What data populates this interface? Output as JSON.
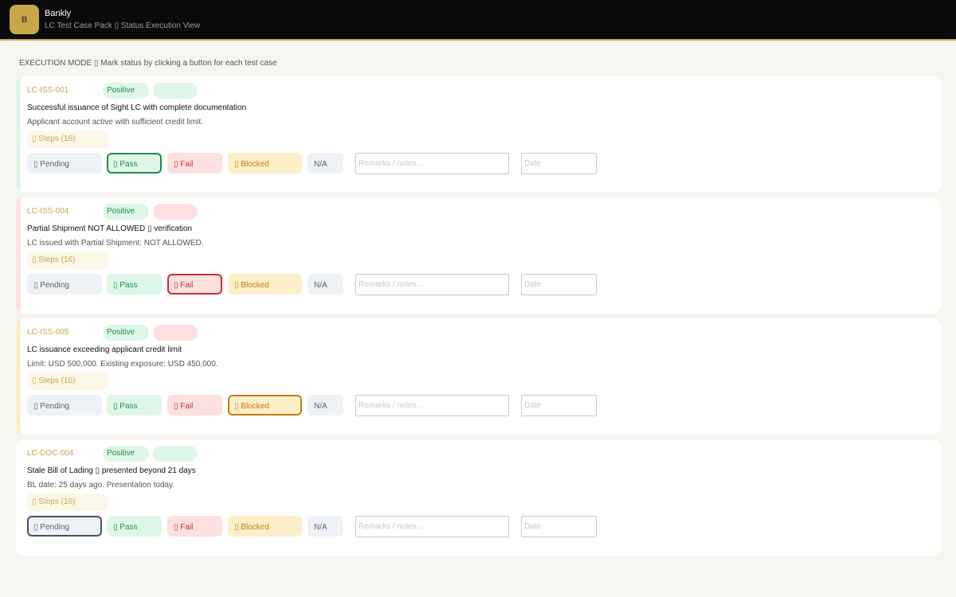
{
  "header": {
    "logo_letter": "B",
    "app_name": "Bankly",
    "subtitle": "LC Test Case Pack ▯ Status Execution View"
  },
  "mode_line": "EXECUTION MODE ▯ Mark status by clicking a button for each test case",
  "buttons": {
    "pending": "▯ Pending",
    "pass": "▯ Pass",
    "fail": "▯ Fail",
    "blocked": "▯ Blocked",
    "na": "N/A"
  },
  "inputs": {
    "remarks_placeholder": "Remarks / notes...",
    "date_placeholder": "Date"
  },
  "colors": {
    "pass": "#1e8b48",
    "fail": "#c43030",
    "blocked": "#c47d12",
    "pending": "#4a5266",
    "accent_gold": "#c9a64a"
  },
  "cases": [
    {
      "id": "LC-ISS-001",
      "type": "Positive",
      "title": "Successful issuance of Sight LC with complete documentation",
      "desc": "Applicant account active with sufficient credit limit.",
      "steps": "▯ Steps (16)",
      "selected": "pass"
    },
    {
      "id": "LC-ISS-004",
      "type": "Positive",
      "title": "Partial Shipment NOT ALLOWED ▯ verification",
      "desc": "LC issued with Partial Shipment: NOT ALLOWED.",
      "steps": "▯ Steps (16)",
      "selected": "fail"
    },
    {
      "id": "LC-ISS-005",
      "type": "Positive",
      "title": "LC issuance exceeding applicant credit limit",
      "desc": "Limit: USD 500,000. Existing exposure: USD 450,000.",
      "steps": "▯ Steps (16)",
      "selected": "blocked"
    },
    {
      "id": "LC-DOC-004",
      "type": "Positive",
      "title": "Stale Bill of Lading ▯ presented beyond 21 days",
      "desc": "BL date: 25 days ago. Presentation today.",
      "steps": "▯ Steps (16)",
      "selected": "pending"
    }
  ]
}
